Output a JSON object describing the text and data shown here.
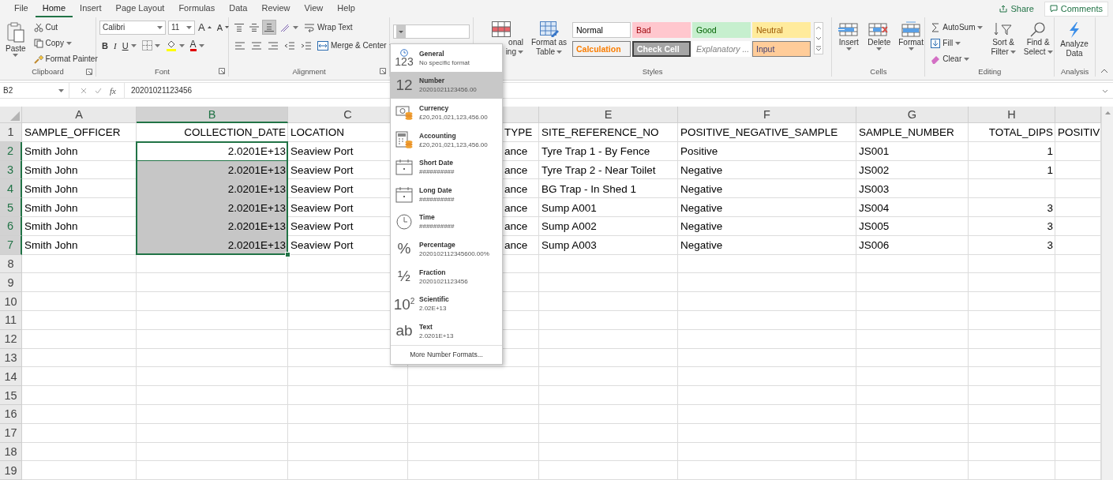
{
  "menu": {
    "tabs": [
      {
        "label": "File",
        "selected": false
      },
      {
        "label": "Home",
        "selected": true
      },
      {
        "label": "Insert",
        "selected": false
      },
      {
        "label": "Page Layout",
        "selected": false
      },
      {
        "label": "Formulas",
        "selected": false
      },
      {
        "label": "Data",
        "selected": false
      },
      {
        "label": "Review",
        "selected": false
      },
      {
        "label": "View",
        "selected": false
      },
      {
        "label": "Help",
        "selected": false
      }
    ],
    "share": "Share",
    "comments": "Comments"
  },
  "ribbon": {
    "clipboard": {
      "paste": "Paste",
      "cut": "Cut",
      "copy": "Copy",
      "format_painter": "Format Painter",
      "label": "Clipboard"
    },
    "font": {
      "name": "Calibri",
      "size": "11",
      "grow": "A",
      "shrink": "A",
      "bold": "B",
      "italic": "I",
      "underline": "U",
      "font_color": "A",
      "label": "Font"
    },
    "alignment": {
      "vertical": [
        {
          "selected": false
        },
        {
          "selected": false
        },
        {
          "selected": true
        }
      ],
      "wrap_text": "Wrap Text",
      "merge_center": "Merge & Center",
      "label": "Alignment"
    },
    "styles": {
      "conditional_formatting": [
        "onal",
        "ing"
      ],
      "format_as_table": [
        "Format as",
        "Table"
      ],
      "gallery": [
        {
          "label": "Normal",
          "kind": "normal"
        },
        {
          "label": "Bad",
          "kind": "bad"
        },
        {
          "label": "Good",
          "kind": "good"
        },
        {
          "label": "Neutral",
          "kind": "neutral"
        },
        {
          "label": "Calculation",
          "kind": "calculation"
        },
        {
          "label": "Check Cell",
          "kind": "check"
        },
        {
          "label": "Explanatory ...",
          "kind": "explanatory"
        },
        {
          "label": "Input",
          "kind": "input"
        }
      ],
      "label": "Styles"
    },
    "cells": {
      "buttons": [
        {
          "label": "Insert",
          "kind": "insert"
        },
        {
          "label": "Delete",
          "kind": "delete"
        },
        {
          "label": "Format",
          "kind": "format"
        }
      ],
      "label": "Cells"
    },
    "editing": {
      "autosum": "AutoSum",
      "fill": "Fill",
      "clear": "Clear",
      "sort_filter": [
        "Sort &",
        "Filter"
      ],
      "find_select": [
        "Find &",
        "Select"
      ],
      "label": "Editing"
    },
    "analysis": {
      "analyze_data": [
        "Analyze",
        "Data"
      ],
      "label": "Analysis"
    }
  },
  "formula_bar": {
    "name_box": "B2",
    "insert_function": "fx",
    "formula": "20201021123456"
  },
  "sheet": {
    "columns": [
      {
        "letter": "A",
        "kind": "text",
        "selected": false
      },
      {
        "letter": "B",
        "kind": "number",
        "selected": true
      },
      {
        "letter": "C",
        "kind": "text",
        "selected": false
      },
      {
        "kind": "partial",
        "selected": false
      },
      {
        "letter": "E",
        "kind": "text",
        "selected": false
      },
      {
        "letter": "F",
        "kind": "text",
        "selected": false
      },
      {
        "letter": "G",
        "kind": "text",
        "selected": false
      },
      {
        "letter": "H",
        "kind": "number",
        "selected": false
      },
      {
        "kind": "text",
        "selected": false
      }
    ],
    "rows": [
      {
        "number": "1",
        "selected": false,
        "active": false,
        "cells": [
          "SAMPLE_OFFICER",
          "COLLECTION_DATE",
          "LOCATION",
          "TYPE",
          "SITE_REFERENCE_NO",
          "POSITIVE_NEGATIVE_SAMPLE",
          "SAMPLE_NUMBER",
          "TOTAL_DIPS",
          "POSITIV"
        ]
      },
      {
        "number": "2",
        "selected": true,
        "active": true,
        "cells": [
          "Smith John",
          "2.0201E+13",
          "Seaview Port",
          "ance",
          "Tyre Trap 1 - By Fence",
          "Positive",
          "JS001",
          "1",
          null
        ]
      },
      {
        "number": "3",
        "selected": true,
        "active": false,
        "cells": [
          "Smith John",
          "2.0201E+13",
          "Seaview Port",
          "ance",
          "Tyre Trap 2 - Near Toilet",
          "Negative",
          "JS002",
          "1",
          null
        ]
      },
      {
        "number": "4",
        "selected": true,
        "active": false,
        "cells": [
          "Smith John",
          "2.0201E+13",
          "Seaview Port",
          "ance",
          "BG Trap - In Shed 1",
          "Negative",
          "JS003",
          null,
          null
        ]
      },
      {
        "number": "5",
        "selected": true,
        "active": false,
        "cells": [
          "Smith John",
          "2.0201E+13",
          "Seaview Port",
          "ance",
          "Sump A001",
          "Negative",
          "JS004",
          "3",
          null
        ]
      },
      {
        "number": "6",
        "selected": true,
        "active": false,
        "cells": [
          "Smith John",
          "2.0201E+13",
          "Seaview Port",
          "ance",
          "Sump A002",
          "Negative",
          "JS005",
          "3",
          null
        ]
      },
      {
        "number": "7",
        "selected": true,
        "active": false,
        "cells": [
          "Smith John",
          "2.0201E+13",
          "Seaview Port",
          "ance",
          "Sump A003",
          "Negative",
          "JS006",
          "3",
          null
        ]
      },
      {
        "number": "8",
        "selected": false,
        "active": false
      },
      {
        "number": "9",
        "selected": false,
        "active": false
      },
      {
        "number": "10",
        "selected": false,
        "active": false
      },
      {
        "number": "11",
        "selected": false,
        "active": false
      },
      {
        "number": "12",
        "selected": false,
        "active": false
      },
      {
        "number": "13",
        "selected": false,
        "active": false
      },
      {
        "number": "14",
        "selected": false,
        "active": false
      },
      {
        "number": "15",
        "selected": false,
        "active": false
      },
      {
        "number": "16",
        "selected": false,
        "active": false
      },
      {
        "number": "17",
        "selected": false,
        "active": false
      },
      {
        "number": "18",
        "selected": false,
        "active": false
      },
      {
        "number": "19",
        "selected": false,
        "active": false
      }
    ]
  },
  "number_format_menu": {
    "items": [
      {
        "kind": "general",
        "symbol": "123",
        "label": "General",
        "sample": "No specific format",
        "selected": false
      },
      {
        "kind": "number",
        "symbol": "12",
        "label": "Number",
        "sample": "20201021123456.00",
        "selected": true
      },
      {
        "kind": "currency",
        "label": "Currency",
        "sample": "£20,201,021,123,456.00",
        "selected": false
      },
      {
        "kind": "accounting",
        "label": "Accounting",
        "sample": "£20,201,021,123,456.00",
        "selected": false
      },
      {
        "kind": "short_date",
        "label": "Short Date",
        "sample": "##########",
        "selected": false
      },
      {
        "kind": "long_date",
        "label": "Long Date",
        "sample": "##########",
        "selected": false
      },
      {
        "kind": "time",
        "label": "Time",
        "sample": "##########",
        "selected": false
      },
      {
        "kind": "percentage",
        "symbol": "%",
        "label": "Percentage",
        "sample": "2020102112345600.00%",
        "selected": false
      },
      {
        "kind": "fraction",
        "symbol": "½",
        "label": "Fraction",
        "sample": "20201021123456",
        "selected": false
      },
      {
        "kind": "scientific",
        "symbol": "10$^{2}$",
        "label": "Scientific",
        "sample": "2.02E+13",
        "selected": false
      },
      {
        "kind": "text",
        "symbol": "ab",
        "label": "Text",
        "sample": "2.0201E+13",
        "selected": false
      }
    ],
    "more": "More Number Formats..."
  }
}
